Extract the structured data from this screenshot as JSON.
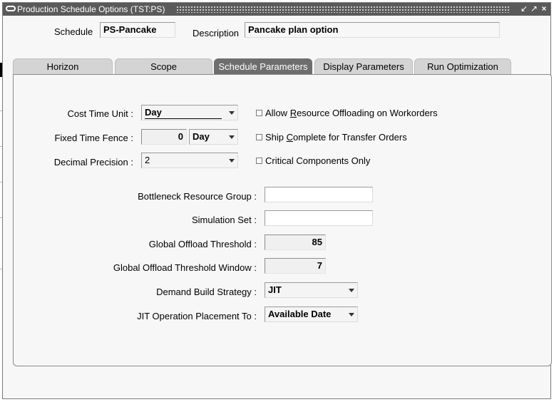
{
  "window": {
    "title": "Production Schedule Options (TST:PS)"
  },
  "header": {
    "schedule_label": "Schedule",
    "schedule_value": "PS-Pancake",
    "description_label": "Description",
    "description_value": "Pancake plan option"
  },
  "tabs": [
    {
      "label": "Horizon",
      "active": false
    },
    {
      "label": "Scope",
      "active": false
    },
    {
      "label": "Schedule Parameters",
      "active": true
    },
    {
      "label": "Display Parameters",
      "active": false
    },
    {
      "label": "Run Optimization",
      "active": false
    }
  ],
  "params": {
    "cost_time_unit_label": "Cost Time Unit :",
    "cost_time_unit_value": "Day",
    "fixed_time_fence_label": "Fixed Time Fence :",
    "fixed_time_fence_value": "0",
    "fixed_time_fence_unit": "Day",
    "decimal_precision_label": "Decimal Precision :",
    "decimal_precision_value": "2",
    "allow_offloading": {
      "before": "Allow ",
      "key": "R",
      "after": "esource Offloading on Workorders",
      "checked": false
    },
    "ship_complete": {
      "before": "Ship ",
      "key": "C",
      "after": "omplete for Transfer Orders",
      "checked": false
    },
    "critical_only": {
      "before": "Critical Components Only",
      "key": "",
      "after": "",
      "checked": false
    },
    "bottleneck_label": "Bottleneck Resource Group :",
    "bottleneck_value": "",
    "simulation_set_label": "Simulation Set :",
    "simulation_set_value": "",
    "offload_threshold_label": "Global Offload Threshold :",
    "offload_threshold_value": "85",
    "offload_window_label": "Global Offload Threshold Window :",
    "offload_window_value": "7",
    "demand_strategy_label": "Demand Build Strategy :",
    "demand_strategy_value": "JIT",
    "jit_placement_label": "JIT Operation Placement To :",
    "jit_placement_value": "Available Date"
  },
  "colors": {
    "titlebar": "#5a5a5a",
    "active_tab": "#6e6e6e",
    "inactive_tab": "#d4d4d4",
    "window_bg": "#f7f7f7"
  }
}
